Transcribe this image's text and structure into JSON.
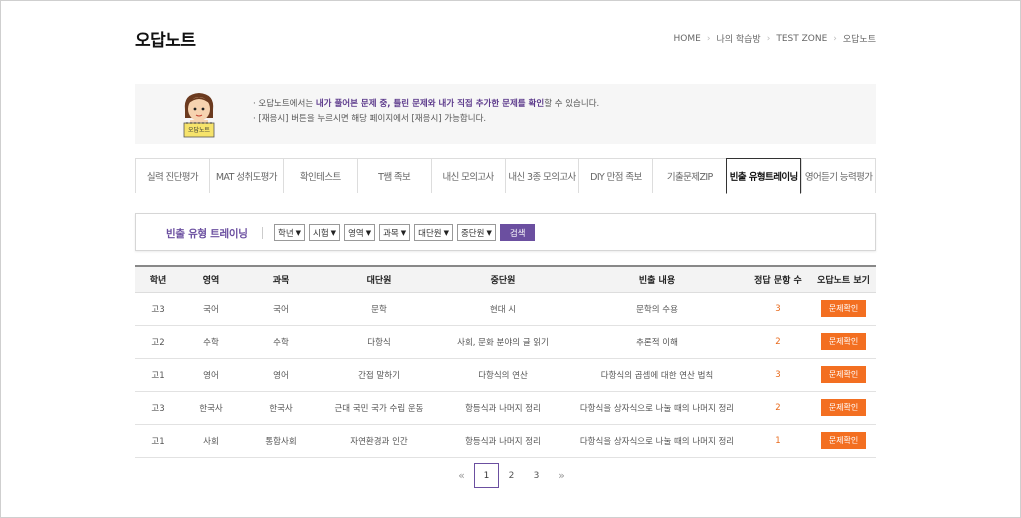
{
  "header": {
    "title": "오답노트",
    "breadcrumb": [
      "HOME",
      "나의 학습방",
      "TEST ZONE",
      "오답노트"
    ]
  },
  "info": {
    "mascot_label": "오답노트",
    "line1_pre": "오답노트에서는 ",
    "line1_bold": "내가 풀어본 문제 중, 틀린 문제와 내가 직접 추가한 문제를 확인",
    "line1_post": "할 수 있습니다.",
    "line2": "[재응시] 버튼을 누르시면 해당 페이지에서 [재응시] 가능합니다."
  },
  "tabs": [
    {
      "label": "실력 진단평가",
      "active": false
    },
    {
      "label": "MAT 성취도평가",
      "active": false
    },
    {
      "label": "확인테스트",
      "active": false
    },
    {
      "label": "T쌤 족보",
      "active": false
    },
    {
      "label": "내신 모의고사",
      "active": false
    },
    {
      "label": "내신 3종 모의고사",
      "active": false
    },
    {
      "label": "DIY 만점 족보",
      "active": false
    },
    {
      "label": "기출문제ZIP",
      "active": false
    },
    {
      "label": "빈출 유형트레이닝",
      "active": true
    },
    {
      "label": "영어듣기 능력평가",
      "active": false
    }
  ],
  "filter": {
    "title": "빈출 유형 트레이닝",
    "selects": [
      "학년",
      "시험",
      "영역",
      "과목",
      "대단원",
      "중단원"
    ],
    "search_label": "검색"
  },
  "table": {
    "headers": [
      "학년",
      "영역",
      "과목",
      "대단원",
      "중단원",
      "빈출 내용",
      "정답 문항 수",
      "오답노트 보기"
    ],
    "button_label": "문제확인",
    "rows": [
      {
        "grade": "고3",
        "area": "국어",
        "subject": "국어",
        "unit": "문학",
        "subunit": "현대 시",
        "content": "문학의 수용",
        "count": "3"
      },
      {
        "grade": "고2",
        "area": "수학",
        "subject": "수학",
        "unit": "다항식",
        "subunit": "사회, 문화 분야의 글 읽기",
        "content": "추론적 이해",
        "count": "2"
      },
      {
        "grade": "고1",
        "area": "영어",
        "subject": "영어",
        "unit": "간접 말하기",
        "subunit": "다항식의 연산",
        "content": "다항식의 곱셈에 대한 연산 법칙",
        "count": "3"
      },
      {
        "grade": "고3",
        "area": "한국사",
        "subject": "한국사",
        "unit": "근대 국민 국가 수립 운동",
        "subunit": "항등식과 나머지 정리",
        "content": "다항식을 상자식으로 나눌 때의 나머지 정리",
        "count": "2"
      },
      {
        "grade": "고1",
        "area": "사회",
        "subject": "통합사회",
        "unit": "자연환경과 인간",
        "subunit": "항등식과 나머지 정리",
        "content": "다항식을 상자식으로 나눌 때의 나머지 정리",
        "count": "1"
      }
    ]
  },
  "pagination": {
    "prev": "«",
    "pages": [
      "1",
      "2",
      "3"
    ],
    "current": "1",
    "next": "»"
  },
  "colors": {
    "accent": "#6b4fa0",
    "button": "#f36f21",
    "count": "#e86a1c"
  }
}
